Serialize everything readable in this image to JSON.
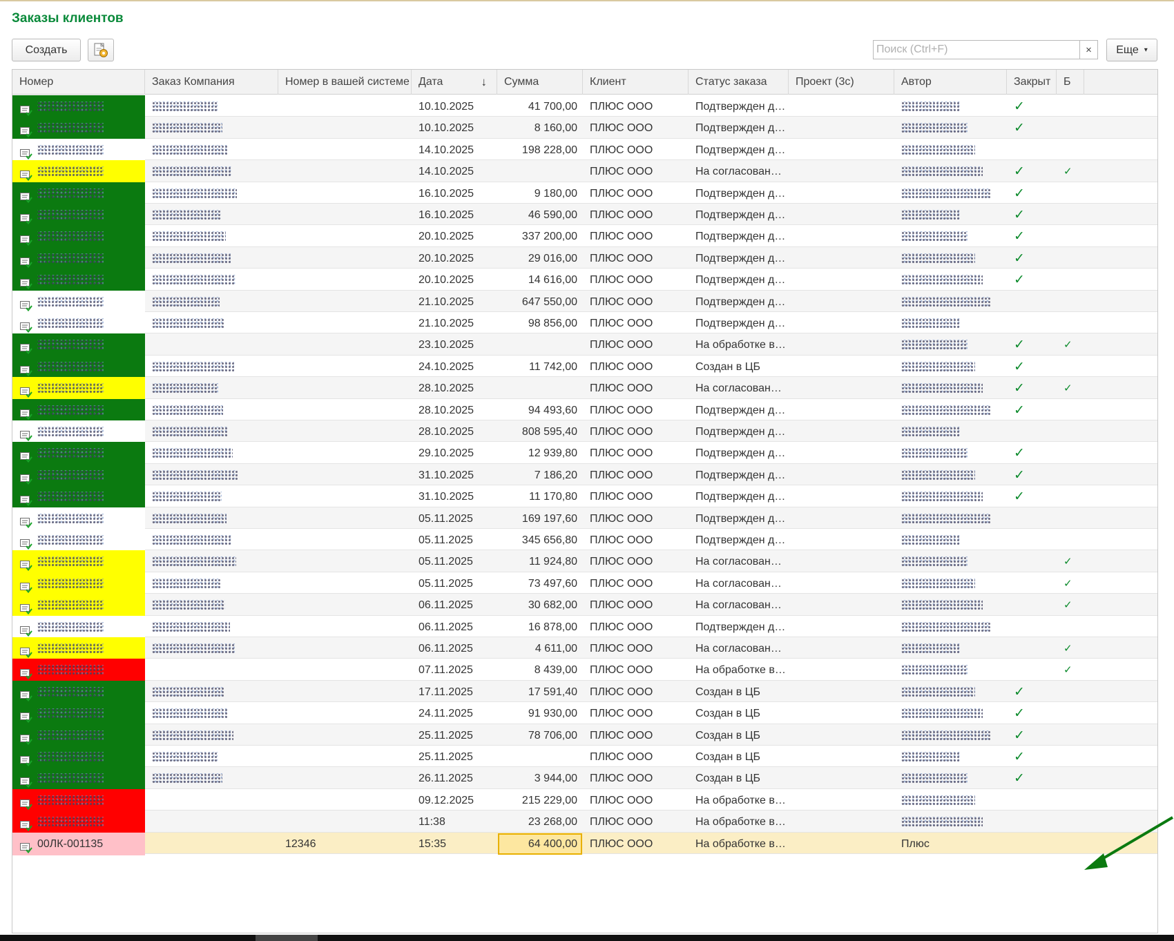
{
  "page": {
    "title": "Заказы клиентов"
  },
  "toolbar": {
    "create_label": "Создать",
    "search_placeholder": "Поиск (Ctrl+F)",
    "search_clear": "×",
    "more_label": "Еще",
    "more_caret": "▾"
  },
  "columns": [
    {
      "key": "number",
      "label": "Номер"
    },
    {
      "key": "company_order",
      "label": "Заказ Компания"
    },
    {
      "key": "your_number",
      "label": "Номер в вашей системе"
    },
    {
      "key": "date",
      "label": "Дата"
    },
    {
      "key": "sum",
      "label": "Сумма"
    },
    {
      "key": "client",
      "label": "Клиент"
    },
    {
      "key": "status",
      "label": "Статус заказа"
    },
    {
      "key": "project",
      "label": "Проект (3с)"
    },
    {
      "key": "author",
      "label": "Автор"
    },
    {
      "key": "closed",
      "label": "Закрыт"
    },
    {
      "key": "extra",
      "label": "Б"
    }
  ],
  "sort_indicator": "↓",
  "colors": {
    "green": "#0b7a10",
    "yellow": "#ffff00",
    "red": "#ff0000",
    "pink": "#ffc0c8",
    "white": "#ffffff",
    "check": "#0b8a2b",
    "title": "#0a8a3a"
  },
  "rows": [
    {
      "color": "green",
      "date": "10.10.2025",
      "sum": "41 700,00",
      "client": "ПЛЮС ООО",
      "status": "Подтвержден д…",
      "closed": true,
      "edge": false,
      "company": true
    },
    {
      "color": "green",
      "date": "10.10.2025",
      "sum": "8 160,00",
      "client": "ПЛЮС ООО",
      "status": "Подтвержден д…",
      "closed": true,
      "edge": false,
      "company": true
    },
    {
      "color": "white",
      "date": "14.10.2025",
      "sum": "198 228,00",
      "client": "ПЛЮС ООО",
      "status": "Подтвержден д…",
      "closed": false,
      "edge": false,
      "company": true
    },
    {
      "color": "yellow",
      "date": "14.10.2025",
      "sum": "",
      "client": "ПЛЮС ООО",
      "status": "На согласован…",
      "closed": true,
      "edge": true,
      "company": true
    },
    {
      "color": "green",
      "date": "16.10.2025",
      "sum": "9 180,00",
      "client": "ПЛЮС ООО",
      "status": "Подтвержден д…",
      "closed": true,
      "edge": false,
      "company": true
    },
    {
      "color": "green",
      "date": "16.10.2025",
      "sum": "46 590,00",
      "client": "ПЛЮС ООО",
      "status": "Подтвержден д…",
      "closed": true,
      "edge": false,
      "company": true
    },
    {
      "color": "green",
      "date": "20.10.2025",
      "sum": "337 200,00",
      "client": "ПЛЮС ООО",
      "status": "Подтвержден д…",
      "closed": true,
      "edge": false,
      "company": true
    },
    {
      "color": "green",
      "date": "20.10.2025",
      "sum": "29 016,00",
      "client": "ПЛЮС ООО",
      "status": "Подтвержден д…",
      "closed": true,
      "edge": false,
      "company": true
    },
    {
      "color": "green",
      "date": "20.10.2025",
      "sum": "14 616,00",
      "client": "ПЛЮС ООО",
      "status": "Подтвержден д…",
      "closed": true,
      "edge": false,
      "company": true
    },
    {
      "color": "white",
      "date": "21.10.2025",
      "sum": "647 550,00",
      "client": "ПЛЮС ООО",
      "status": "Подтвержден д…",
      "closed": false,
      "edge": false,
      "company": true
    },
    {
      "color": "white",
      "date": "21.10.2025",
      "sum": "98 856,00",
      "client": "ПЛЮС ООО",
      "status": "Подтвержден д…",
      "closed": false,
      "edge": false,
      "company": true
    },
    {
      "color": "green",
      "date": "23.10.2025",
      "sum": "",
      "client": "ПЛЮС ООО",
      "status": "На обработке в…",
      "closed": true,
      "edge": true,
      "company": false
    },
    {
      "color": "green",
      "date": "24.10.2025",
      "sum": "11 742,00",
      "client": "ПЛЮС ООО",
      "status": "Создан в ЦБ",
      "closed": true,
      "edge": false,
      "company": true
    },
    {
      "color": "yellow",
      "date": "28.10.2025",
      "sum": "",
      "client": "ПЛЮС ООО",
      "status": "На согласован…",
      "closed": true,
      "edge": true,
      "company": true
    },
    {
      "color": "green",
      "date": "28.10.2025",
      "sum": "94 493,60",
      "client": "ПЛЮС ООО",
      "status": "Подтвержден д…",
      "closed": true,
      "edge": false,
      "company": true
    },
    {
      "color": "white",
      "date": "28.10.2025",
      "sum": "808 595,40",
      "client": "ПЛЮС ООО",
      "status": "Подтвержден д…",
      "closed": false,
      "edge": false,
      "company": true
    },
    {
      "color": "green",
      "date": "29.10.2025",
      "sum": "12 939,80",
      "client": "ПЛЮС ООО",
      "status": "Подтвержден д…",
      "closed": true,
      "edge": false,
      "company": true
    },
    {
      "color": "green",
      "date": "31.10.2025",
      "sum": "7 186,20",
      "client": "ПЛЮС ООО",
      "status": "Подтвержден д…",
      "closed": true,
      "edge": false,
      "company": true
    },
    {
      "color": "green",
      "date": "31.10.2025",
      "sum": "11 170,80",
      "client": "ПЛЮС ООО",
      "status": "Подтвержден д…",
      "closed": true,
      "edge": false,
      "company": true
    },
    {
      "color": "white",
      "date": "05.11.2025",
      "sum": "169 197,60",
      "client": "ПЛЮС ООО",
      "status": "Подтвержден д…",
      "closed": false,
      "edge": false,
      "company": true
    },
    {
      "color": "white",
      "date": "05.11.2025",
      "sum": "345 656,80",
      "client": "ПЛЮС ООО",
      "status": "Подтвержден д…",
      "closed": false,
      "edge": false,
      "company": true
    },
    {
      "color": "yellow",
      "date": "05.11.2025",
      "sum": "11 924,80",
      "client": "ПЛЮС ООО",
      "status": "На согласован…",
      "closed": false,
      "edge": true,
      "company": true
    },
    {
      "color": "yellow",
      "date": "05.11.2025",
      "sum": "73 497,60",
      "client": "ПЛЮС ООО",
      "status": "На согласован…",
      "closed": false,
      "edge": true,
      "company": true
    },
    {
      "color": "yellow",
      "date": "06.11.2025",
      "sum": "30 682,00",
      "client": "ПЛЮС ООО",
      "status": "На согласован…",
      "closed": false,
      "edge": true,
      "company": true
    },
    {
      "color": "white",
      "date": "06.11.2025",
      "sum": "16 878,00",
      "client": "ПЛЮС ООО",
      "status": "Подтвержден д…",
      "closed": false,
      "edge": false,
      "company": true
    },
    {
      "color": "yellow",
      "date": "06.11.2025",
      "sum": "4 611,00",
      "client": "ПЛЮС ООО",
      "status": "На согласован…",
      "closed": false,
      "edge": true,
      "company": true
    },
    {
      "color": "red",
      "date": "07.11.2025",
      "sum": "8 439,00",
      "client": "ПЛЮС ООО",
      "status": "На обработке в…",
      "closed": false,
      "edge": true,
      "company": false
    },
    {
      "color": "green",
      "date": "17.11.2025",
      "sum": "17 591,40",
      "client": "ПЛЮС ООО",
      "status": "Создан в ЦБ",
      "closed": true,
      "edge": false,
      "company": true
    },
    {
      "color": "green",
      "date": "24.11.2025",
      "sum": "91 930,00",
      "client": "ПЛЮС ООО",
      "status": "Создан в ЦБ",
      "closed": true,
      "edge": false,
      "company": true
    },
    {
      "color": "green",
      "date": "25.11.2025",
      "sum": "78 706,00",
      "client": "ПЛЮС ООО",
      "status": "Создан в ЦБ",
      "closed": true,
      "edge": false,
      "company": true
    },
    {
      "color": "green",
      "date": "25.11.2025",
      "sum": "",
      "client": "ПЛЮС ООО",
      "status": "Создан в ЦБ",
      "closed": true,
      "edge": false,
      "company": true
    },
    {
      "color": "green",
      "date": "26.11.2025",
      "sum": "3 944,00",
      "client": "ПЛЮС ООО",
      "status": "Создан в ЦБ",
      "closed": true,
      "edge": false,
      "company": true
    },
    {
      "color": "red",
      "date": "09.12.2025",
      "sum": "215 229,00",
      "client": "ПЛЮС ООО",
      "status": "На обработке в…",
      "closed": false,
      "edge": false,
      "company": false
    },
    {
      "color": "red",
      "date": "11:38",
      "sum": "23 268,00",
      "client": "ПЛЮС ООО",
      "status": "На обработке в…",
      "closed": false,
      "edge": false,
      "company": false
    },
    {
      "color": "pink",
      "selected": true,
      "number": "00ЛК-001135",
      "your_number": "12346",
      "date": "15:35",
      "sum": "64 400,00",
      "client": "ПЛЮС ООО",
      "status": "На обработке в…",
      "author": "Плюс",
      "closed": false,
      "edge": false,
      "company": false
    }
  ]
}
